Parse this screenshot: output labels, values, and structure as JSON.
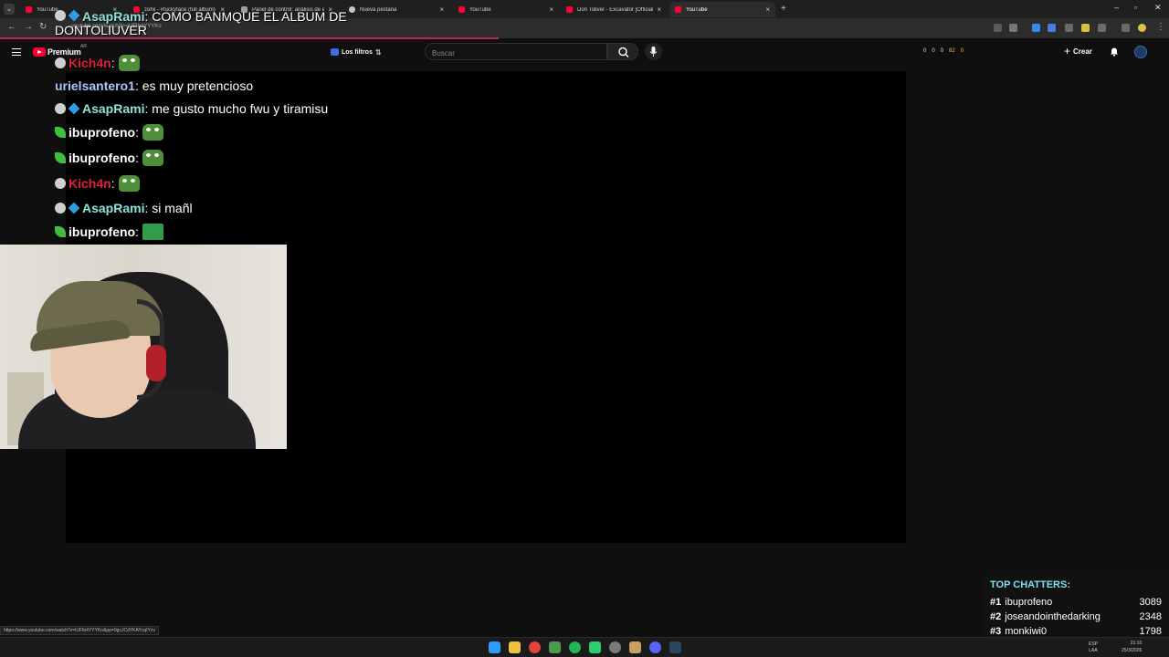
{
  "browser": {
    "tabs": [
      {
        "label": "YouTube",
        "favicon": "youtube-icon",
        "active": false
      },
      {
        "label": "zohii - #fuckyface (full album)",
        "favicon": "youtube-icon",
        "active": false
      },
      {
        "label": "Panel de control: análisis de en",
        "favicon": "document-icon",
        "active": false
      },
      {
        "label": "Nueva pestaña",
        "favicon": "chrome-icon",
        "active": false
      },
      {
        "label": "YouTube",
        "favicon": "youtube-icon",
        "active": false
      },
      {
        "label": "Don Toliver - Excavator [Official",
        "favicon": "youtube-icon",
        "active": false
      },
      {
        "label": "YouTube",
        "favicon": "youtube-icon",
        "active": true
      }
    ],
    "url": "youtube.com/watch?v=iUFIb4YYYKo",
    "status_url": "https://www.youtube.com/watch?v=iUFIb4YYYKo&pp=0gcJCdYKAYcqIYzv"
  },
  "youtube": {
    "premium_label": "Premium",
    "country": "AR",
    "filters_label": "Los filtros",
    "search_placeholder": "Buscar",
    "create_label": "Crear",
    "stats": [
      "0",
      "0",
      "0",
      "82",
      "0"
    ]
  },
  "chat": {
    "messages": [
      {
        "user": "AsapRami",
        "color": "#8fe3d6",
        "badges": [
          "round",
          "cube"
        ],
        "text": ": COMO BANMQUE EL ALBUM DE DONTOLIUVER",
        "emote": false
      },
      {
        "user": "Kich4n",
        "color": "#e0203a",
        "badges": [
          "round"
        ],
        "text": ":",
        "emote": true
      },
      {
        "user": "urielsantero1",
        "color": "#a9c6ff",
        "badges": [],
        "text": ": es muy pretencioso",
        "emote": false
      },
      {
        "user": "AsapRami",
        "color": "#8fe3d6",
        "badges": [
          "round",
          "cube"
        ],
        "text": ": me gusto mucho fwu y tiramisu",
        "emote": false
      },
      {
        "user": "ibuprofeno",
        "color": "#ffffff",
        "badges": [
          "leaf"
        ],
        "text": ":",
        "emote": true
      },
      {
        "user": "ibuprofeno",
        "color": "#ffffff",
        "badges": [
          "leaf"
        ],
        "text": ":",
        "emote": true
      },
      {
        "user": "Kich4n",
        "color": "#e0203a",
        "badges": [
          "round"
        ],
        "text": ":",
        "emote": true
      },
      {
        "user": "AsapRami",
        "color": "#8fe3d6",
        "badges": [
          "round",
          "cube"
        ],
        "text": ": si mañl",
        "emote": false
      },
      {
        "user": "ibuprofeno",
        "color": "#ffffff",
        "badges": [
          "leaf"
        ],
        "text": ":",
        "emote": true
      }
    ]
  },
  "top_chatters": {
    "title": "TOP CHATTERS:",
    "entries": [
      {
        "rank": "#1",
        "name": "ibuprofeno",
        "count": "3089"
      },
      {
        "rank": "#2",
        "name": "joseandointhedarking",
        "count": "2348"
      },
      {
        "rank": "#3",
        "name": "monkiwi0",
        "count": "1798"
      }
    ]
  },
  "taskbar": {
    "lang_top": "ESP",
    "lang_bottom": "LAA",
    "time": "21:10",
    "date": "25/3/2026"
  },
  "colors": {
    "youtube_red": "#ff0033",
    "accent_cyan": "#7fe0f0",
    "page_bg": "#0f0f0f"
  }
}
